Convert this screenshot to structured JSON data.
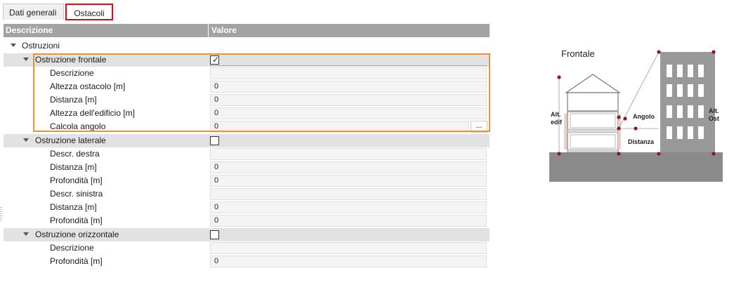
{
  "tabs": [
    {
      "label": "Dati generali",
      "active": false
    },
    {
      "label": "Ostacoli",
      "active": true
    }
  ],
  "grid": {
    "col_descrizione": "Descrizione",
    "col_valore": "Valore",
    "category": "Ostruzioni",
    "groups": [
      {
        "label": "Ostruzione frontale",
        "checked": true,
        "rows": [
          {
            "label": "Descrizione",
            "value": ""
          },
          {
            "label": "Altezza ostacolo [m]",
            "value": "0"
          },
          {
            "label": "Distanza [m]",
            "value": "0"
          },
          {
            "label": "Altezza dell'edificio [m]",
            "value": "0"
          },
          {
            "label": "Calcola angolo",
            "value": "0",
            "button": "..."
          }
        ]
      },
      {
        "label": "Ostruzione laterale",
        "checked": false,
        "rows": [
          {
            "label": "Descr. destra",
            "value": ""
          },
          {
            "label": "Distanza [m]",
            "value": "0"
          },
          {
            "label": "Profondità [m]",
            "value": "0"
          },
          {
            "label": "Descr. sinistra",
            "value": ""
          },
          {
            "label": "Distanza [m]",
            "value": "0"
          },
          {
            "label": "Profondità [m]",
            "value": "0"
          }
        ]
      },
      {
        "label": "Ostruzione orizzontale",
        "checked": false,
        "rows": [
          {
            "label": "Descrizione",
            "value": ""
          },
          {
            "label": "Profondità [m]",
            "value": "0"
          }
        ]
      }
    ]
  },
  "diagram": {
    "title": "Frontale",
    "label_alt_edif_1": "Alt.",
    "label_alt_edif_2": "edif",
    "label_angolo": "Angolo",
    "label_alt_ost_1": "Alt.",
    "label_alt_ost_2": "Ost",
    "label_distanza": "Distanza",
    "colors": {
      "ground": "#8a8a8a",
      "building": "#999999",
      "dot": "#8b1538",
      "highlight": "#f39130",
      "tab_active": "#d01020"
    }
  }
}
